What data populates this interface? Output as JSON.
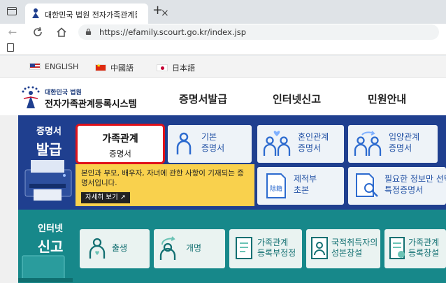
{
  "browser": {
    "tab_title": "대한민국 법원 전자가족관계등록시",
    "url": "https://efamily.scourt.go.kr/index.jsp"
  },
  "languages": [
    {
      "label": "ENGLISH",
      "flag": "us-flag"
    },
    {
      "label": "中國語",
      "flag": "cn-flag"
    },
    {
      "label": "日本語",
      "flag": "jp-flag"
    }
  ],
  "header": {
    "logo_small": "대한민국 법원",
    "logo_main": "전자가족관계등록시스템",
    "nav": [
      "증명서발급",
      "인터넷신고",
      "민원안내"
    ]
  },
  "issue": {
    "title_small": "증명서",
    "title_big": "발급",
    "active_card": {
      "line1": "가족관계",
      "line2": "증명서"
    },
    "cards": [
      {
        "line1": "기본",
        "line2": "증명서",
        "icon": "person-icon"
      },
      {
        "line1": "혼인관계",
        "line2": "증명서",
        "icon": "couple-icon"
      },
      {
        "line1": "입양관계",
        "line2": "증명서",
        "icon": "adoption-icon"
      },
      {
        "line1": "제적부",
        "line2": "초본",
        "icon": "document-icon"
      },
      {
        "line1": "필요한 정보만 선택",
        "line2": "특정증명서",
        "icon": "search-doc-icon"
      }
    ],
    "description": "본인과 부모, 배우자, 자녀에 관한 사항이 기재되는 증명서입니다.",
    "detail_button": "자세히 보기"
  },
  "report": {
    "title_small": "인터넷",
    "title_big": "신고",
    "cards": [
      {
        "line1": "출생",
        "line2": "",
        "icon": "baby-icon"
      },
      {
        "line1": "개명",
        "line2": "",
        "icon": "rename-icon"
      },
      {
        "line1": "가족관계",
        "line2": "등록부정정",
        "icon": "form-icon"
      },
      {
        "line1": "국적취득자의",
        "line2": "성본창설",
        "icon": "id-card-icon"
      },
      {
        "line1": "가족관계",
        "line2": "등록창설",
        "icon": "register-icon"
      }
    ]
  },
  "colors": {
    "issue_bg": "#1f3f8f",
    "report_bg": "#17888a",
    "highlight": "#e0121a",
    "desc_bg": "#f9d14d"
  }
}
